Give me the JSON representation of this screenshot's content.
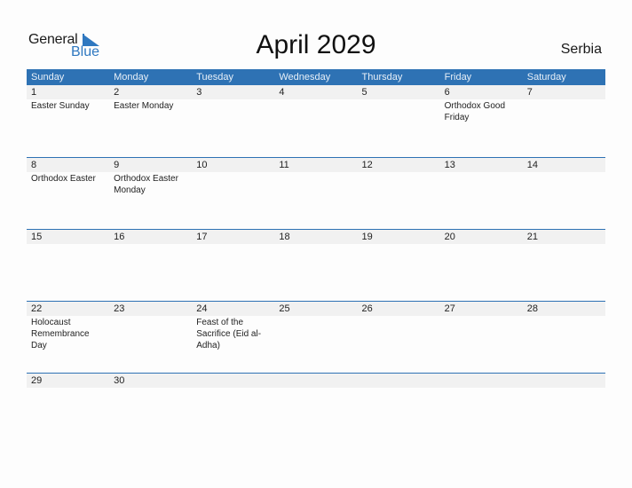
{
  "logo": {
    "part1": "General",
    "part2": "Blue",
    "icon": "triangle-flag-icon"
  },
  "title": "April 2029",
  "country": "Serbia",
  "colors": {
    "header_bg": "#2e72b4",
    "date_strip": "#f1f1f1",
    "brand_blue": "#2f78c0"
  },
  "weekdays": [
    "Sunday",
    "Monday",
    "Tuesday",
    "Wednesday",
    "Thursday",
    "Friday",
    "Saturday"
  ],
  "weeks": [
    [
      {
        "date": "1",
        "holiday": "Easter Sunday"
      },
      {
        "date": "2",
        "holiday": "Easter Monday"
      },
      {
        "date": "3",
        "holiday": ""
      },
      {
        "date": "4",
        "holiday": ""
      },
      {
        "date": "5",
        "holiday": ""
      },
      {
        "date": "6",
        "holiday": "Orthodox Good Friday"
      },
      {
        "date": "7",
        "holiday": ""
      }
    ],
    [
      {
        "date": "8",
        "holiday": "Orthodox Easter"
      },
      {
        "date": "9",
        "holiday": "Orthodox Easter Monday"
      },
      {
        "date": "10",
        "holiday": ""
      },
      {
        "date": "11",
        "holiday": ""
      },
      {
        "date": "12",
        "holiday": ""
      },
      {
        "date": "13",
        "holiday": ""
      },
      {
        "date": "14",
        "holiday": ""
      }
    ],
    [
      {
        "date": "15",
        "holiday": ""
      },
      {
        "date": "16",
        "holiday": ""
      },
      {
        "date": "17",
        "holiday": ""
      },
      {
        "date": "18",
        "holiday": ""
      },
      {
        "date": "19",
        "holiday": ""
      },
      {
        "date": "20",
        "holiday": ""
      },
      {
        "date": "21",
        "holiday": ""
      }
    ],
    [
      {
        "date": "22",
        "holiday": "Holocaust Remembrance Day"
      },
      {
        "date": "23",
        "holiday": ""
      },
      {
        "date": "24",
        "holiday": "Feast of the Sacrifice (Eid al-Adha)"
      },
      {
        "date": "25",
        "holiday": ""
      },
      {
        "date": "26",
        "holiday": ""
      },
      {
        "date": "27",
        "holiday": ""
      },
      {
        "date": "28",
        "holiday": ""
      }
    ],
    [
      {
        "date": "29",
        "holiday": ""
      },
      {
        "date": "30",
        "holiday": ""
      },
      {
        "date": "",
        "holiday": ""
      },
      {
        "date": "",
        "holiday": ""
      },
      {
        "date": "",
        "holiday": ""
      },
      {
        "date": "",
        "holiday": ""
      },
      {
        "date": "",
        "holiday": ""
      }
    ]
  ]
}
